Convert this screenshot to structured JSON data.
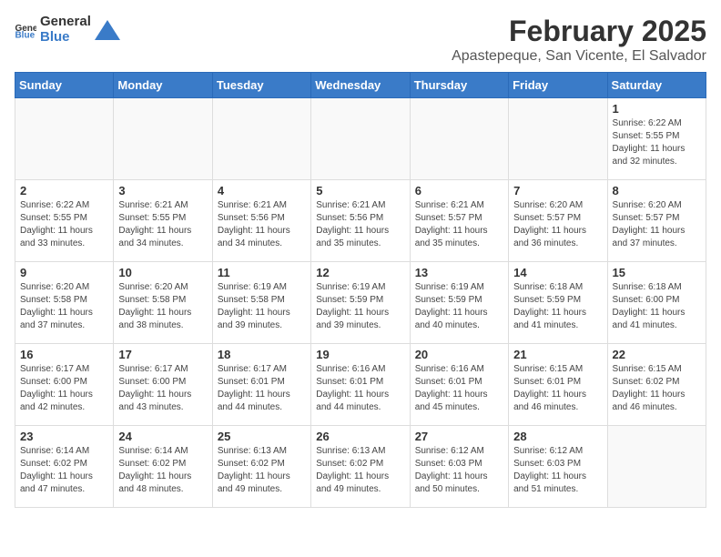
{
  "header": {
    "logo_general": "General",
    "logo_blue": "Blue",
    "month_title": "February 2025",
    "location": "Apastepeque, San Vicente, El Salvador"
  },
  "days_of_week": [
    "Sunday",
    "Monday",
    "Tuesday",
    "Wednesday",
    "Thursday",
    "Friday",
    "Saturday"
  ],
  "weeks": [
    [
      {
        "day": "",
        "info": ""
      },
      {
        "day": "",
        "info": ""
      },
      {
        "day": "",
        "info": ""
      },
      {
        "day": "",
        "info": ""
      },
      {
        "day": "",
        "info": ""
      },
      {
        "day": "",
        "info": ""
      },
      {
        "day": "1",
        "info": "Sunrise: 6:22 AM\nSunset: 5:55 PM\nDaylight: 11 hours and 32 minutes."
      }
    ],
    [
      {
        "day": "2",
        "info": "Sunrise: 6:22 AM\nSunset: 5:55 PM\nDaylight: 11 hours and 33 minutes."
      },
      {
        "day": "3",
        "info": "Sunrise: 6:21 AM\nSunset: 5:55 PM\nDaylight: 11 hours and 34 minutes."
      },
      {
        "day": "4",
        "info": "Sunrise: 6:21 AM\nSunset: 5:56 PM\nDaylight: 11 hours and 34 minutes."
      },
      {
        "day": "5",
        "info": "Sunrise: 6:21 AM\nSunset: 5:56 PM\nDaylight: 11 hours and 35 minutes."
      },
      {
        "day": "6",
        "info": "Sunrise: 6:21 AM\nSunset: 5:57 PM\nDaylight: 11 hours and 35 minutes."
      },
      {
        "day": "7",
        "info": "Sunrise: 6:20 AM\nSunset: 5:57 PM\nDaylight: 11 hours and 36 minutes."
      },
      {
        "day": "8",
        "info": "Sunrise: 6:20 AM\nSunset: 5:57 PM\nDaylight: 11 hours and 37 minutes."
      }
    ],
    [
      {
        "day": "9",
        "info": "Sunrise: 6:20 AM\nSunset: 5:58 PM\nDaylight: 11 hours and 37 minutes."
      },
      {
        "day": "10",
        "info": "Sunrise: 6:20 AM\nSunset: 5:58 PM\nDaylight: 11 hours and 38 minutes."
      },
      {
        "day": "11",
        "info": "Sunrise: 6:19 AM\nSunset: 5:58 PM\nDaylight: 11 hours and 39 minutes."
      },
      {
        "day": "12",
        "info": "Sunrise: 6:19 AM\nSunset: 5:59 PM\nDaylight: 11 hours and 39 minutes."
      },
      {
        "day": "13",
        "info": "Sunrise: 6:19 AM\nSunset: 5:59 PM\nDaylight: 11 hours and 40 minutes."
      },
      {
        "day": "14",
        "info": "Sunrise: 6:18 AM\nSunset: 5:59 PM\nDaylight: 11 hours and 41 minutes."
      },
      {
        "day": "15",
        "info": "Sunrise: 6:18 AM\nSunset: 6:00 PM\nDaylight: 11 hours and 41 minutes."
      }
    ],
    [
      {
        "day": "16",
        "info": "Sunrise: 6:17 AM\nSunset: 6:00 PM\nDaylight: 11 hours and 42 minutes."
      },
      {
        "day": "17",
        "info": "Sunrise: 6:17 AM\nSunset: 6:00 PM\nDaylight: 11 hours and 43 minutes."
      },
      {
        "day": "18",
        "info": "Sunrise: 6:17 AM\nSunset: 6:01 PM\nDaylight: 11 hours and 44 minutes."
      },
      {
        "day": "19",
        "info": "Sunrise: 6:16 AM\nSunset: 6:01 PM\nDaylight: 11 hours and 44 minutes."
      },
      {
        "day": "20",
        "info": "Sunrise: 6:16 AM\nSunset: 6:01 PM\nDaylight: 11 hours and 45 minutes."
      },
      {
        "day": "21",
        "info": "Sunrise: 6:15 AM\nSunset: 6:01 PM\nDaylight: 11 hours and 46 minutes."
      },
      {
        "day": "22",
        "info": "Sunrise: 6:15 AM\nSunset: 6:02 PM\nDaylight: 11 hours and 46 minutes."
      }
    ],
    [
      {
        "day": "23",
        "info": "Sunrise: 6:14 AM\nSunset: 6:02 PM\nDaylight: 11 hours and 47 minutes."
      },
      {
        "day": "24",
        "info": "Sunrise: 6:14 AM\nSunset: 6:02 PM\nDaylight: 11 hours and 48 minutes."
      },
      {
        "day": "25",
        "info": "Sunrise: 6:13 AM\nSunset: 6:02 PM\nDaylight: 11 hours and 49 minutes."
      },
      {
        "day": "26",
        "info": "Sunrise: 6:13 AM\nSunset: 6:02 PM\nDaylight: 11 hours and 49 minutes."
      },
      {
        "day": "27",
        "info": "Sunrise: 6:12 AM\nSunset: 6:03 PM\nDaylight: 11 hours and 50 minutes."
      },
      {
        "day": "28",
        "info": "Sunrise: 6:12 AM\nSunset: 6:03 PM\nDaylight: 11 hours and 51 minutes."
      },
      {
        "day": "",
        "info": ""
      }
    ]
  ]
}
